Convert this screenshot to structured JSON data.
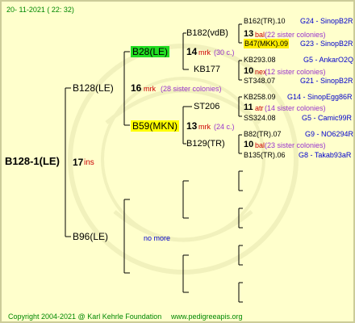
{
  "header": {
    "timestamp": "20- 11-2021 ( 22: 32)"
  },
  "root": {
    "label": "B128-1(LE)",
    "num": "17",
    "abbr": "ins"
  },
  "gen1": [
    {
      "label": "B128(LE)",
      "num": "16",
      "abbr": "mrk",
      "note": "(28 sister colonies)"
    },
    {
      "label": "B96(LE)",
      "note": "no more"
    }
  ],
  "gen2": [
    {
      "label": "B28(LE)",
      "num": "14",
      "abbr": "mrk",
      "note": "(30 c.)"
    },
    {
      "label": "B59(MKN)",
      "num": "13",
      "abbr": "mrk",
      "note": "(24 c.)"
    }
  ],
  "gen3": [
    {
      "label": "B182(vdB)",
      "num": "13",
      "abbr": "bal",
      "note": "(22 sister colonies)"
    },
    {
      "label": "KB177",
      "num": "10",
      "abbr": "nex",
      "note": "(12 sister colonies)"
    },
    {
      "label": "ST206",
      "num": "11",
      "abbr": "atr",
      "note": "(14 sister colonies)"
    },
    {
      "label": "B129(TR)",
      "num": "10",
      "abbr": "bal",
      "note": "(23 sister colonies)"
    }
  ],
  "gen4": [
    {
      "label": "B162(TR).10",
      "code": "G24 - SinopB2R"
    },
    {
      "label": "B47(MKK).09",
      "code": "G23 - SinopB2R"
    },
    {
      "label": "KB293.08",
      "code": "G5 - AnkarO2Q"
    },
    {
      "label": "ST348.07",
      "code": "G21 - SinopB2R"
    },
    {
      "label": "KB258.09",
      "code": "G14 - SinopEgg86R"
    },
    {
      "label": "SS324.08",
      "code": "G5 - Camic99R"
    },
    {
      "label": "B82(TR).07",
      "code": "G9 - NO6294R"
    },
    {
      "label": "B135(TR).06",
      "code": "G8 - Takab93aR"
    }
  ],
  "footer": {
    "copyright": "Copyright 2004-2021 @ Karl Kehrle Foundation",
    "site": "www.pedigreeapis.org"
  }
}
